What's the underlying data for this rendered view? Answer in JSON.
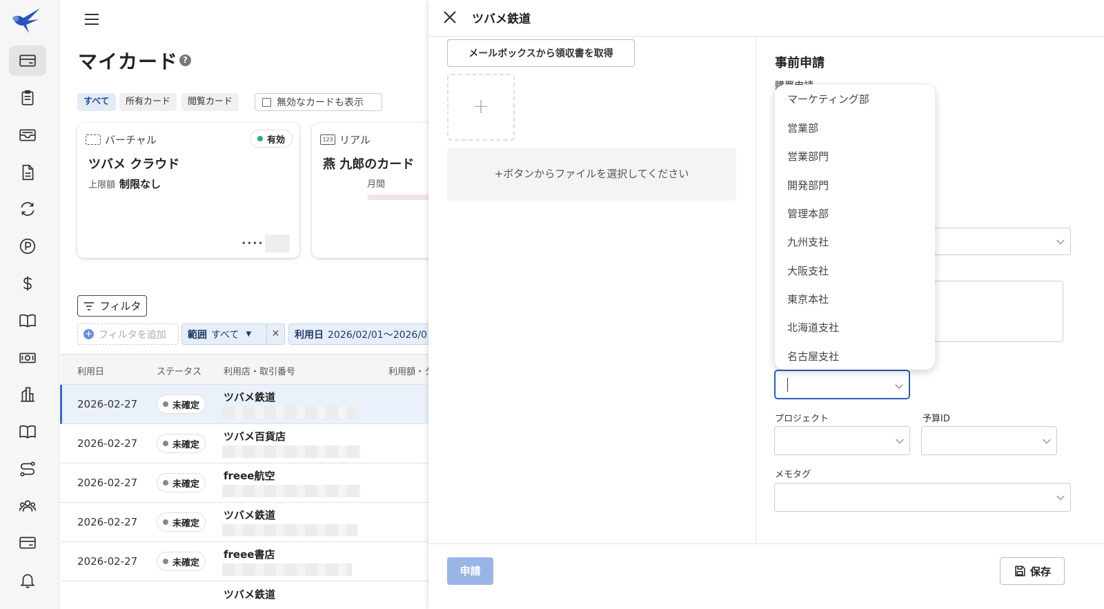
{
  "sidebar": {
    "icons": [
      "bird-logo-icon",
      "credit-card-icon",
      "clipboard-icon",
      "inbox-icon",
      "document-icon",
      "sync-icon",
      "parking-icon",
      "dollar-icon",
      "book-icon",
      "banknote-icon",
      "building-icon",
      "book-open-icon",
      "route-icon",
      "users-icon",
      "card-icon",
      "bell-icon"
    ]
  },
  "main": {
    "title": "マイカード",
    "chips": [
      "すべて",
      "所有カード",
      "閲覧カード"
    ],
    "show_inactive_label": "無効なカードも表示",
    "cards": [
      {
        "type": "バーチャル",
        "status": "有効",
        "name": "ツバメ クラウド",
        "limit_label": "上限額",
        "limit_value": "制限なし",
        "number_mask": "••••"
      },
      {
        "type": "リアル",
        "type_icon": "123",
        "name": "燕 九郎のカード",
        "period": "月間"
      }
    ],
    "filter_button": "フィルタ",
    "add_filter": "フィルタを追加",
    "range_filter": {
      "label": "範囲",
      "value": "すべて"
    },
    "date_filter": {
      "label": "利用日",
      "value": "2026/02/01〜2026/0"
    },
    "table": {
      "headers": [
        "利用日",
        "ステータス",
        "利用店・取引番号",
        "利用額・タ"
      ],
      "rows": [
        {
          "date": "2026-02-27",
          "status": "未確定",
          "shop": "ツバメ鉄道"
        },
        {
          "date": "2026-02-27",
          "status": "未確定",
          "shop": "ツバメ百貨店"
        },
        {
          "date": "2026-02-27",
          "status": "未確定",
          "shop": "freee航空"
        },
        {
          "date": "2026-02-27",
          "status": "未確定",
          "shop": "ツバメ鉄道"
        },
        {
          "date": "2026-02-27",
          "status": "未確定",
          "shop": "freee書店"
        },
        {
          "date": "",
          "status": "",
          "shop": "ツバメ鉄道"
        }
      ]
    }
  },
  "panel": {
    "title": "ツバメ鉄道",
    "mailbox_button": "メールボックスから領収書を取得",
    "upload_plus": "+",
    "drop_hint": "+ボタンからファイルを選択してください",
    "section_title": "事前申請",
    "sub_label": "購買申請",
    "project_label": "プロジェクト",
    "budget_label": "予算ID",
    "memo_label": "メモタグ",
    "apply_button": "申請",
    "save_button": "保存",
    "department_options": [
      "マーケティング部",
      "営業部",
      "営業部門",
      "開発部門",
      "管理本部",
      "九州支社",
      "大阪支社",
      "東京本社",
      "北海道支社",
      "名古屋支社"
    ]
  }
}
